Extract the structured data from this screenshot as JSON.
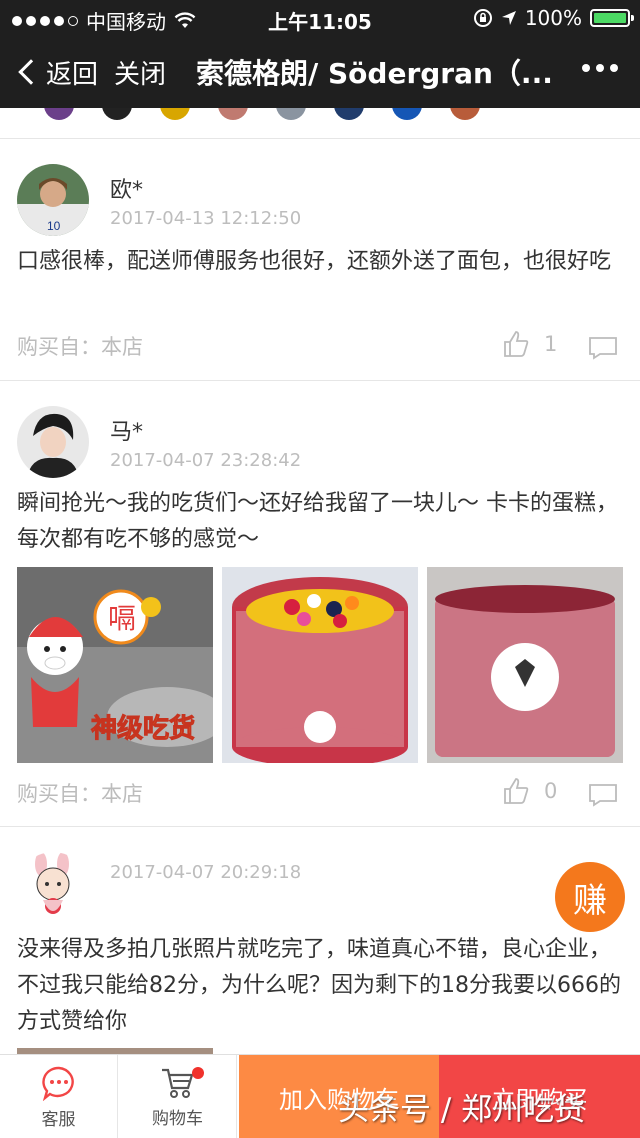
{
  "status_bar": {
    "carrier": "中国移动",
    "time": "上午11:05",
    "battery": "100%"
  },
  "nav": {
    "back_label": "返回",
    "close_label": "关闭",
    "title": "索德格朗/ Södergran（..."
  },
  "reviews": [
    {
      "name": "欧*",
      "time": "2017-04-13 12:12:50",
      "text": "口感很棒，配送师傅服务也很好，还额外送了面包，也很好吃",
      "source_label": "购买自：",
      "source_value": "本店",
      "likes": "1"
    },
    {
      "name": "马*",
      "time": "2017-04-07 23:28:42",
      "text": "瞬间抢光～我的吃货们～还好给我留了一块儿～ 卡卡的蛋糕，每次都有吃不够的感觉～",
      "source_label": "购买自：",
      "source_value": "本店",
      "likes": "0",
      "photo_text": {
        "sticker_top": "嗝",
        "sticker_bottom": "神级吃货"
      }
    },
    {
      "name": "",
      "time": "2017-04-07 20:29:18",
      "text": "没来得及多拍几张照片就吃完了，味道真心不错，良心企业，不过我只能给82分，为什么呢？因为剩下的18分我要以666的方式赞给你"
    }
  ],
  "earn_label": "赚",
  "bottom_bar": {
    "service_label": "客服",
    "cart_label": "购物车",
    "add_to_cart": "加入购物车",
    "buy_now": "立即购买"
  },
  "watermark": "头条号 / 郑州吃货",
  "colors": {
    "nav_bg": "#1f1f1f",
    "accent_orange": "#fd8a44",
    "accent_red": "#f24646",
    "earn_orange": "#f4781c"
  }
}
